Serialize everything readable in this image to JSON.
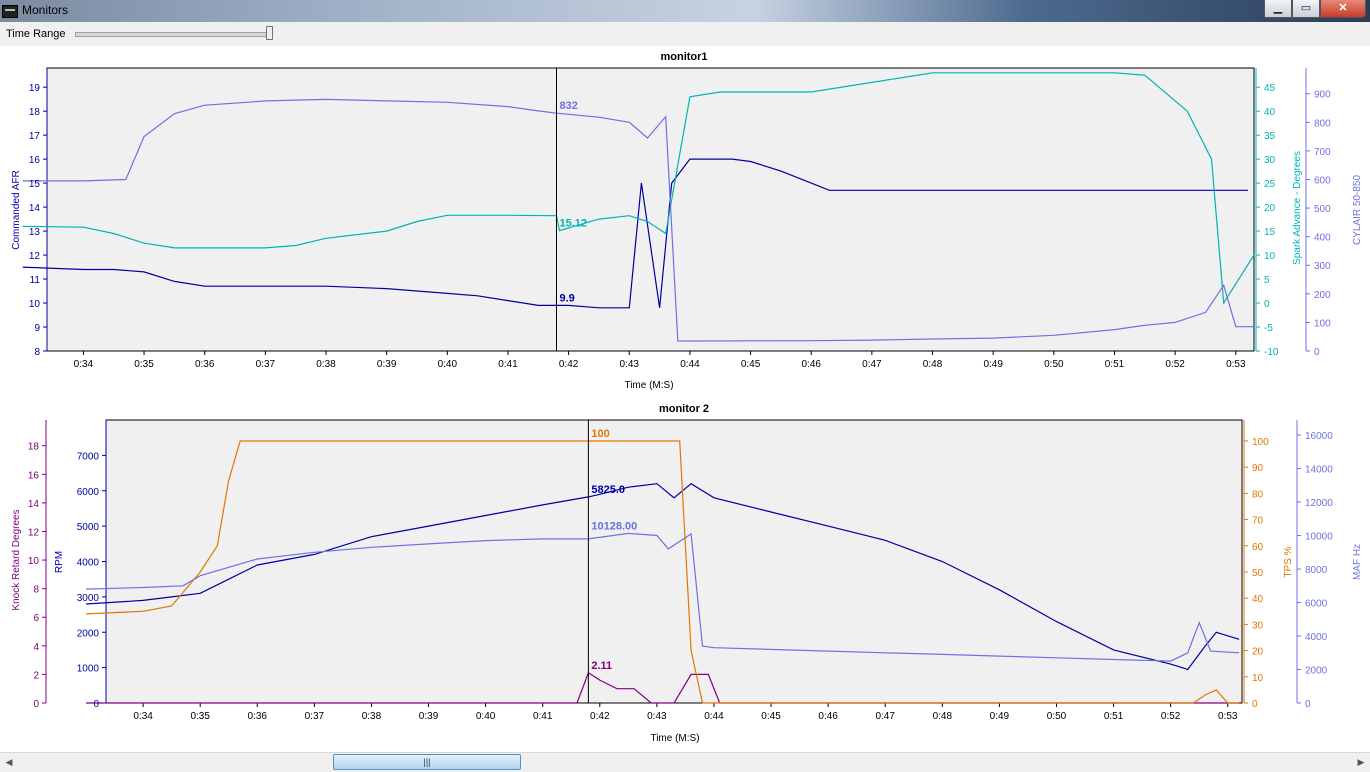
{
  "window": {
    "title": "Monitors",
    "minimize": "▁",
    "maximize": "▭",
    "close": "✕"
  },
  "toolbar": {
    "time_range_label": "Time Range",
    "time_range_position": 1.0
  },
  "x_ticks": [
    "0:34",
    "0:35",
    "0:36",
    "0:37",
    "0:38",
    "0:39",
    "0:40",
    "0:41",
    "0:42",
    "0:43",
    "0:44",
    "0:45",
    "0:46",
    "0:47",
    "0:48",
    "0:49",
    "0:50",
    "0:51",
    "0:52",
    "0:53"
  ],
  "chart_data": [
    {
      "type": "line",
      "title": "monitor1",
      "xlabel": "Time (M:S)",
      "cursor_x": 41.8,
      "axes": {
        "left": {
          "label": "Commanded AFR",
          "ticks": [
            "8",
            "9",
            "10",
            "11",
            "12",
            "13",
            "14",
            "15",
            "16",
            "17",
            "18",
            "19"
          ],
          "min": 8,
          "max": 19.8,
          "color": "#0000a0"
        },
        "right1": {
          "label": "Spark Advance - Degrees",
          "ticks": [
            "-10",
            "-5",
            "0",
            "5",
            "10",
            "15",
            "20",
            "25",
            "30",
            "35",
            "40",
            "45"
          ],
          "min": -10,
          "max": 49,
          "color": "#00b4b4"
        },
        "right2": {
          "label": "CYLAIR 50-850",
          "ticks": [
            "0",
            "100",
            "200",
            "300",
            "400",
            "500",
            "600",
            "700",
            "800",
            "900"
          ],
          "min": 0,
          "max": 990,
          "color": "#7070e0"
        }
      },
      "series": [
        {
          "name": "Commanded AFR",
          "axis": "left",
          "color": "#0000a0",
          "cursor_value": "9.9",
          "points": [
            [
              33,
              11.5
            ],
            [
              34,
              11.4
            ],
            [
              34.5,
              11.4
            ],
            [
              35,
              11.3
            ],
            [
              35.5,
              10.9
            ],
            [
              36,
              10.7
            ],
            [
              37,
              10.7
            ],
            [
              38,
              10.7
            ],
            [
              39,
              10.6
            ],
            [
              40,
              10.4
            ],
            [
              40.5,
              10.3
            ],
            [
              41,
              10.1
            ],
            [
              41.5,
              9.9
            ],
            [
              42,
              9.9
            ],
            [
              42.5,
              9.8
            ],
            [
              43,
              9.8
            ],
            [
              43.2,
              15.0
            ],
            [
              43.5,
              9.8
            ],
            [
              43.7,
              15.0
            ],
            [
              44,
              16.0
            ],
            [
              44.7,
              16.0
            ],
            [
              45,
              15.9
            ],
            [
              45.5,
              15.5
            ],
            [
              46,
              15.0
            ],
            [
              46.3,
              14.7
            ],
            [
              47,
              14.7
            ],
            [
              53.2,
              14.7
            ]
          ]
        },
        {
          "name": "Spark Advance",
          "axis": "right1",
          "color": "#00b4b4",
          "cursor_value": "15.12",
          "points": [
            [
              33,
              16
            ],
            [
              34,
              15.8
            ],
            [
              34.5,
              14.5
            ],
            [
              35,
              12.5
            ],
            [
              35.5,
              11.5
            ],
            [
              36,
              11.5
            ],
            [
              37,
              11.5
            ],
            [
              37.5,
              12
            ],
            [
              38,
              13.5
            ],
            [
              39,
              15
            ],
            [
              39.5,
              17
            ],
            [
              40,
              18.3
            ],
            [
              41,
              18.3
            ],
            [
              41.8,
              18.2
            ],
            [
              41.85,
              15.1
            ],
            [
              42.5,
              17.5
            ],
            [
              43,
              18.2
            ],
            [
              43.3,
              17
            ],
            [
              43.6,
              14.5
            ],
            [
              44,
              43
            ],
            [
              44.5,
              44
            ],
            [
              46,
              44
            ],
            [
              47,
              46
            ],
            [
              47.5,
              47
            ],
            [
              48,
              48
            ],
            [
              51,
              48
            ],
            [
              51.5,
              47.5
            ],
            [
              52.2,
              40
            ],
            [
              52.6,
              30
            ],
            [
              52.8,
              0
            ],
            [
              53.3,
              10
            ]
          ]
        },
        {
          "name": "CYLAIR",
          "axis": "right2",
          "color": "#7070e0",
          "cursor_value": "832",
          "points": [
            [
              33,
              595
            ],
            [
              34,
              595
            ],
            [
              34.7,
              600
            ],
            [
              35,
              750
            ],
            [
              35.5,
              830
            ],
            [
              36,
              860
            ],
            [
              36.7,
              870
            ],
            [
              37,
              875
            ],
            [
              38,
              880
            ],
            [
              39,
              875
            ],
            [
              40,
              870
            ],
            [
              41,
              855
            ],
            [
              41.5,
              840
            ],
            [
              41.8,
              832
            ],
            [
              42.5,
              818
            ],
            [
              43,
              800
            ],
            [
              43.3,
              745
            ],
            [
              43.6,
              820
            ],
            [
              43.8,
              35
            ],
            [
              44,
              35
            ],
            [
              46,
              36
            ],
            [
              47,
              38
            ],
            [
              48,
              42
            ],
            [
              49,
              45
            ],
            [
              50,
              55
            ],
            [
              51,
              75
            ],
            [
              51.5,
              90
            ],
            [
              52,
              100
            ],
            [
              52.5,
              135
            ],
            [
              52.8,
              230
            ],
            [
              53,
              85
            ],
            [
              53.3,
              85
            ]
          ]
        }
      ]
    },
    {
      "type": "line",
      "title": "monitor 2",
      "xlabel": "Time (M:S)",
      "cursor_x": 41.8,
      "axes": {
        "left0": {
          "label": "Knock Retard Degrees",
          "ticks": [
            "0",
            "2",
            "4",
            "6",
            "8",
            "10",
            "12",
            "14",
            "16",
            "18"
          ],
          "min": 0,
          "max": 19.8,
          "color": "#800080"
        },
        "left1": {
          "label": "RPM",
          "ticks": [
            "0",
            "1000",
            "2000",
            "3000",
            "4000",
            "5000",
            "6000",
            "7000"
          ],
          "min": 0,
          "max": 8000,
          "color": "#0000a0"
        },
        "right1": {
          "label": "TPS %",
          "ticks": [
            "0",
            "10",
            "20",
            "30",
            "40",
            "50",
            "60",
            "70",
            "80",
            "90",
            "100"
          ],
          "min": 0,
          "max": 108,
          "color": "#e07800"
        },
        "right2": {
          "label": "MAF Hz",
          "ticks": [
            "0",
            "2000",
            "4000",
            "6000",
            "8000",
            "10000",
            "12000",
            "14000",
            "16000"
          ],
          "min": 0,
          "max": 16900,
          "color": "#7070e0"
        }
      },
      "series": [
        {
          "name": "Knock Retard",
          "axis": "left0",
          "color": "#800080",
          "cursor_value": "2.11",
          "points": [
            [
              33,
              0
            ],
            [
              41.6,
              0
            ],
            [
              41.8,
              2.11
            ],
            [
              42,
              1.6
            ],
            [
              42.3,
              1
            ],
            [
              42.6,
              1
            ],
            [
              42.9,
              0
            ],
            [
              43.3,
              0
            ],
            [
              43.6,
              2
            ],
            [
              43.9,
              2
            ],
            [
              44.1,
              0
            ],
            [
              53.2,
              0
            ]
          ]
        },
        {
          "name": "RPM",
          "axis": "left1",
          "color": "#0000a0",
          "cursor_value": "5825.0",
          "points": [
            [
              33,
              2800
            ],
            [
              34,
              2900
            ],
            [
              34.5,
              3000
            ],
            [
              35,
              3100
            ],
            [
              35.5,
              3500
            ],
            [
              36,
              3900
            ],
            [
              37,
              4200
            ],
            [
              38,
              4700
            ],
            [
              39,
              5000
            ],
            [
              40,
              5300
            ],
            [
              41,
              5600
            ],
            [
              41.8,
              5825
            ],
            [
              42,
              5900
            ],
            [
              42.5,
              6100
            ],
            [
              43,
              6200
            ],
            [
              43.3,
              5800
            ],
            [
              43.6,
              6200
            ],
            [
              44,
              5800
            ],
            [
              45,
              5400
            ],
            [
              46,
              5000
            ],
            [
              47,
              4600
            ],
            [
              48,
              4000
            ],
            [
              49,
              3200
            ],
            [
              50,
              2300
            ],
            [
              51,
              1500
            ],
            [
              52,
              1100
            ],
            [
              52.3,
              950
            ],
            [
              52.6,
              1600
            ],
            [
              52.8,
              2000
            ],
            [
              53.2,
              1800
            ]
          ]
        },
        {
          "name": "TPS",
          "axis": "right1",
          "color": "#e07800",
          "cursor_value": "100",
          "points": [
            [
              33,
              34
            ],
            [
              34,
              35
            ],
            [
              34.5,
              37
            ],
            [
              35,
              50
            ],
            [
              35.3,
              60
            ],
            [
              35.5,
              85
            ],
            [
              35.7,
              100
            ],
            [
              43.4,
              100
            ],
            [
              43.6,
              20
            ],
            [
              43.8,
              0
            ],
            [
              52.4,
              0
            ],
            [
              52.6,
              3
            ],
            [
              52.8,
              5
            ],
            [
              53,
              0
            ],
            [
              53.2,
              0
            ]
          ]
        },
        {
          "name": "MAF",
          "axis": "right2",
          "color": "#7070e0",
          "cursor_value": "10128.00",
          "points": [
            [
              33,
              6800
            ],
            [
              34,
              6900
            ],
            [
              34.7,
              7000
            ],
            [
              35,
              7600
            ],
            [
              36,
              8600
            ],
            [
              37,
              9000
            ],
            [
              38,
              9300
            ],
            [
              39,
              9500
            ],
            [
              40,
              9700
            ],
            [
              41,
              9800
            ],
            [
              41.8,
              9800
            ],
            [
              42.5,
              10128
            ],
            [
              43,
              10000
            ],
            [
              43.2,
              9200
            ],
            [
              43.6,
              10100
            ],
            [
              43.8,
              3400
            ],
            [
              44,
              3300
            ],
            [
              46,
              3100
            ],
            [
              47,
              3000
            ],
            [
              48,
              2900
            ],
            [
              49,
              2800
            ],
            [
              50,
              2700
            ],
            [
              51,
              2600
            ],
            [
              52,
              2500
            ],
            [
              52.3,
              3000
            ],
            [
              52.5,
              4800
            ],
            [
              52.7,
              3100
            ],
            [
              53.2,
              3000
            ]
          ]
        }
      ]
    }
  ]
}
